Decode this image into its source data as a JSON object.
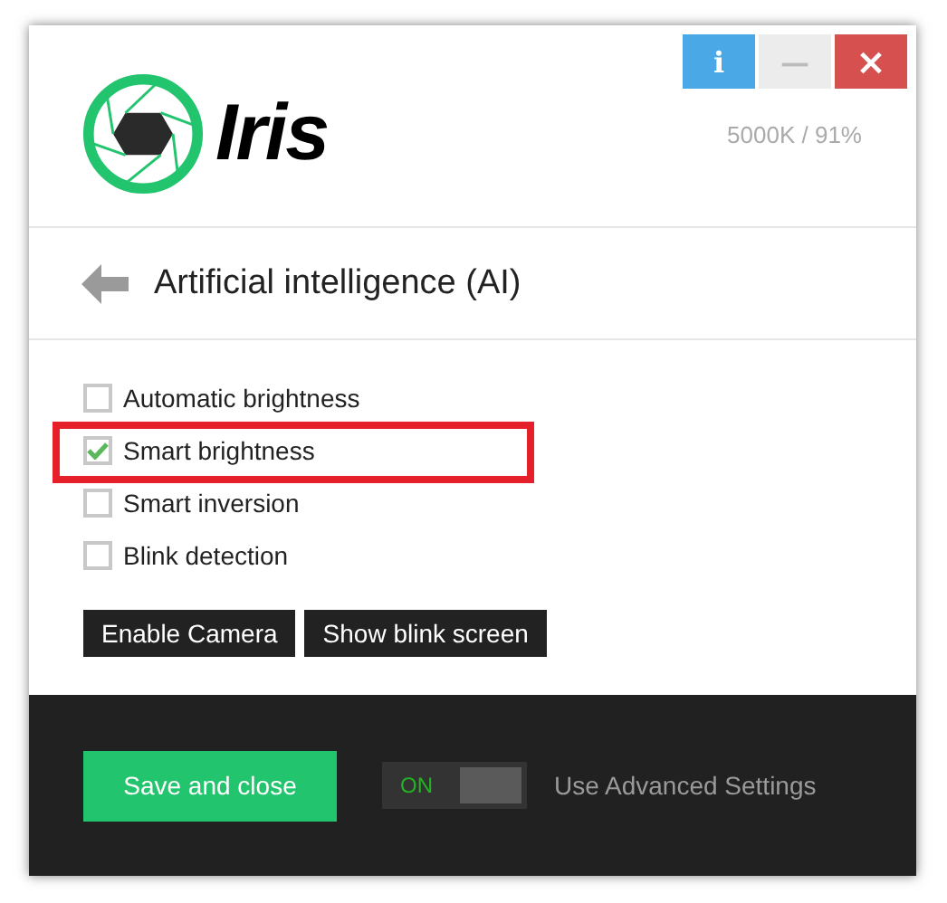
{
  "header": {
    "logo_text": "Iris",
    "status": "5000K / 91%",
    "window_buttons": [
      {
        "kind": "info",
        "label": "i"
      },
      {
        "kind": "minimize",
        "label": "—"
      },
      {
        "kind": "close",
        "label": "×"
      }
    ]
  },
  "section": {
    "title": "Artificial intelligence (AI)"
  },
  "options": [
    {
      "label": "Automatic brightness",
      "checked": false,
      "highlighted": false
    },
    {
      "label": "Smart brightness",
      "checked": true,
      "highlighted": true
    },
    {
      "label": "Smart inversion",
      "checked": false,
      "highlighted": false
    },
    {
      "label": "Blink detection",
      "checked": false,
      "highlighted": false
    }
  ],
  "actions": [
    "Enable Camera",
    "Show blink screen"
  ],
  "footer": {
    "save_button": "Save and close",
    "toggle": {
      "label": "ON",
      "on": true
    },
    "toggle_caption": "Use Advanced Settings"
  }
}
